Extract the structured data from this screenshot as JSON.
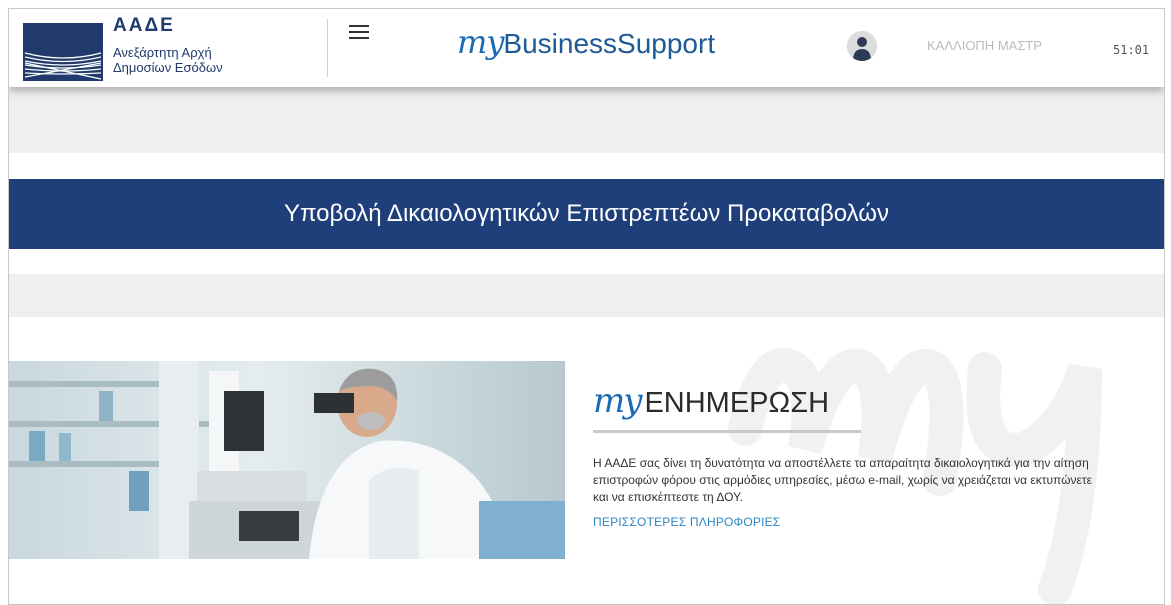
{
  "header": {
    "brand_abbr": "ΑΑΔΕ",
    "brand_line1": "Ανεξάρτητη Αρχή",
    "brand_line2": "Δημοσίων Εσόδων",
    "app_title_my": "my",
    "app_title_rest": "BusinessSupport",
    "user_name": "ΚΑΛΛΙΟΠΗ ΜΑΣΤΡ",
    "session_timer": "51:01",
    "menu_icon": "hamburger-menu-icon",
    "avatar_icon": "user-icon"
  },
  "page": {
    "title": "Υποβολή Δικαιολογητικών Επιστρεπτέων Προκαταβολών"
  },
  "info": {
    "title_my": "my",
    "title_word": "ΕΝΗΜΕΡΩΣΗ",
    "description": "Η ΑΑΔΕ σας δίνει τη δυνατότητα να αποστέλλετε τα απαραίτητα δικαιολογητικά για την αίτηση επιστροφών φόρου στις αρμόδιες υπηρεσίες, μέσω e-mail, χωρίς να χρειάζεται να εκτυπώνετε και να επισκέπτεστε τη ΔΟΥ.",
    "more_link": "ΠΕΡΙΣΣΟΤΕΡΕΣ ΠΛΗΡΟΦΟΡΙΕΣ"
  },
  "colors": {
    "brand_navy": "#1f3a6b",
    "title_bar": "#1f3f7a",
    "accent_blue": "#1a6ab5",
    "link_blue": "#2e86c1",
    "band_gray": "#efefef"
  }
}
